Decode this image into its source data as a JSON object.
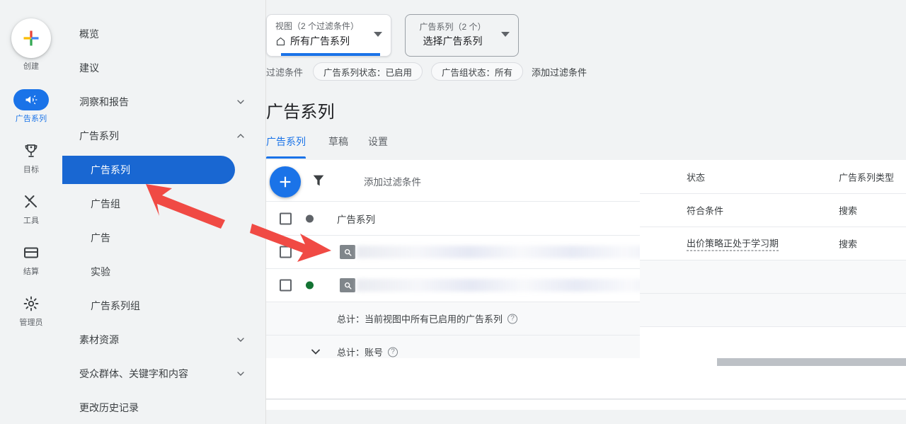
{
  "rail": {
    "items": [
      {
        "label": "创建",
        "icon": "plus-icon",
        "type": "create",
        "active": false
      },
      {
        "label": "广告系列",
        "icon": "megaphone-icon",
        "type": "pill",
        "active": true
      },
      {
        "label": "目标",
        "icon": "trophy-icon",
        "type": "plain",
        "active": false
      },
      {
        "label": "工具",
        "icon": "tools-icon",
        "type": "plain",
        "active": false
      },
      {
        "label": "结算",
        "icon": "credit-card-icon",
        "type": "plain",
        "active": false
      },
      {
        "label": "管理员",
        "icon": "gear-icon",
        "type": "plain",
        "active": false
      }
    ]
  },
  "nav": {
    "items": [
      {
        "label": "概览",
        "expandable": false,
        "sub": false,
        "selected": false
      },
      {
        "label": "建议",
        "expandable": false,
        "sub": false,
        "selected": false
      },
      {
        "label": "洞察和报告",
        "expandable": true,
        "expanded": false,
        "sub": false,
        "selected": false
      },
      {
        "label": "广告系列",
        "expandable": true,
        "expanded": true,
        "sub": false,
        "selected": false
      },
      {
        "label": "广告系列",
        "expandable": false,
        "sub": true,
        "selected": true
      },
      {
        "label": "广告组",
        "expandable": false,
        "sub": true,
        "selected": false
      },
      {
        "label": "广告",
        "expandable": false,
        "sub": true,
        "selected": false
      },
      {
        "label": "实验",
        "expandable": false,
        "sub": true,
        "selected": false
      },
      {
        "label": "广告系列组",
        "expandable": false,
        "sub": true,
        "selected": false
      },
      {
        "label": "素材资源",
        "expandable": true,
        "expanded": false,
        "sub": false,
        "selected": false
      },
      {
        "label": "受众群体、关键字和内容",
        "expandable": true,
        "expanded": false,
        "sub": false,
        "selected": false
      },
      {
        "label": "更改历史记录",
        "expandable": false,
        "sub": false,
        "selected": false
      }
    ]
  },
  "selectors": {
    "view": {
      "top_label": "视图（2 个过滤条件）",
      "value": "所有广告系列",
      "icon": "home-icon"
    },
    "campaign": {
      "top_label": "广告系列（2 个）",
      "value": "选择广告系列"
    }
  },
  "filters": {
    "label": "过滤条件",
    "chips": [
      "广告系列状态：已启用",
      "广告组状态：所有"
    ],
    "add_label": "添加过滤条件"
  },
  "page": {
    "title": "广告系列"
  },
  "tabs": [
    {
      "label": "广告系列",
      "active": true
    },
    {
      "label": "草稿",
      "active": false
    },
    {
      "label": "设置",
      "active": false
    }
  ],
  "toolbar": {
    "add_icon": "plus-icon",
    "filter_icon": "funnel-icon",
    "add_filter_label": "添加过滤条件"
  },
  "table": {
    "columns": {
      "name": "广告系列",
      "status": "状态",
      "type": "广告系列类型"
    },
    "header_dot_color": "#5f6368",
    "rows": [
      {
        "checked": false,
        "dot_color": "#137333",
        "name_redacted": true,
        "name_icon": "search-badge-icon",
        "status": "符合条件",
        "status_dashed": false,
        "type": "搜索"
      },
      {
        "checked": false,
        "dot_color": "#137333",
        "name_redacted": true,
        "name_icon": "search-badge-icon",
        "status": "出价策略正处于学习期",
        "status_dashed": true,
        "type": "搜索"
      }
    ],
    "totals": [
      {
        "label": "总计：当前视图中所有已启用的广告系列",
        "help": "?",
        "expandable": false
      },
      {
        "label": "总计：账号",
        "help": "?",
        "expandable": true
      }
    ]
  },
  "colors": {
    "accent_blue": "#1a73e8",
    "selected_nav_blue": "#1967d2",
    "status_green": "#137333",
    "annotation_red": "#f04a44",
    "page_bg": "#f1f3f4"
  },
  "annotations": {
    "arrow_1": "points to selected sidebar item 广告系列",
    "arrow_2": "points to first campaign row"
  }
}
